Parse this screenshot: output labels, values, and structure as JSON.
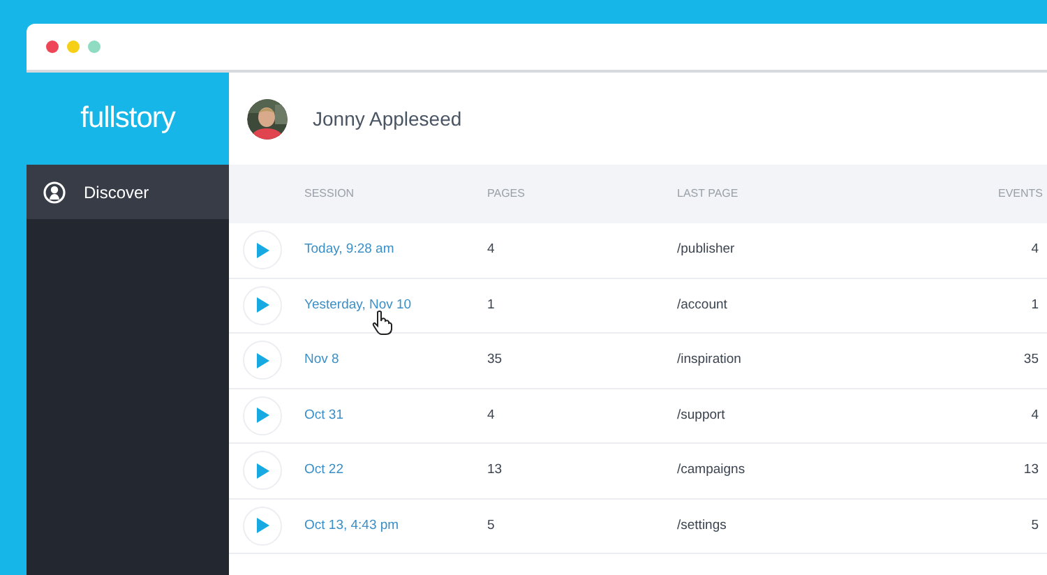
{
  "sidebar": {
    "logo": "fullstory",
    "items": [
      {
        "label": "Discover",
        "selected": true
      }
    ]
  },
  "user": {
    "name": "Jonny Appleseed"
  },
  "table": {
    "columns": [
      "SESSION",
      "PAGES",
      "LAST PAGE",
      "EVENTS"
    ],
    "rows": [
      {
        "session": "Today, 9:28 am",
        "pages": "4",
        "last_page": "/publisher",
        "events": "4"
      },
      {
        "session": "Yesterday, Nov 10",
        "pages": "1",
        "last_page": "/account",
        "events": "1"
      },
      {
        "session": "Nov 8",
        "pages": "35",
        "last_page": "/inspiration",
        "events": "35"
      },
      {
        "session": "Oct 31",
        "pages": "4",
        "last_page": "/support",
        "events": "4"
      },
      {
        "session": "Oct 22",
        "pages": "13",
        "last_page": "/campaigns",
        "events": "13"
      },
      {
        "session": "Oct 13, 4:43 pm",
        "pages": "5",
        "last_page": "/settings",
        "events": "5"
      }
    ]
  }
}
